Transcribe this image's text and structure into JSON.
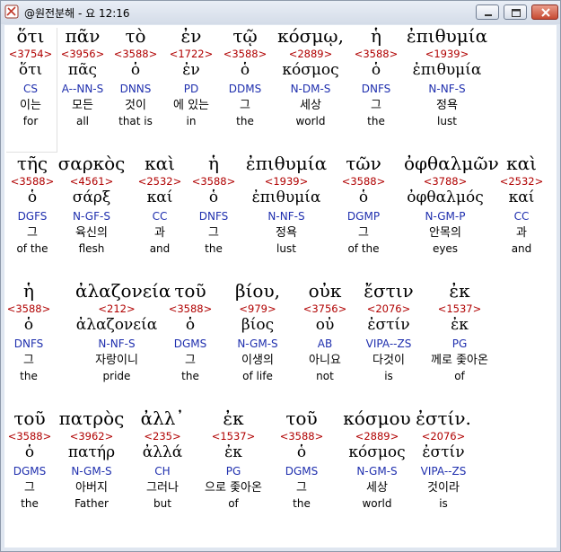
{
  "window": {
    "title": "@원전분해 - 요 12:16"
  },
  "rows": [
    [
      {
        "greek": "ὅτι",
        "strong": "<3754>",
        "lemma": "ὅτι",
        "parse": "CS",
        "korean": "이는",
        "english": "for"
      },
      {
        "greek": "πᾶν",
        "strong": "<3956>",
        "lemma": "πᾶς",
        "parse": "A--NN-S",
        "korean": "모든",
        "english": "all"
      },
      {
        "greek": "τὸ",
        "strong": "<3588>",
        "lemma": "ὁ",
        "parse": "DNNS",
        "korean": "것이",
        "english": "that is"
      },
      {
        "greek": "ἐν",
        "strong": "<1722>",
        "lemma": "ἐν",
        "parse": "PD",
        "korean": "에 있는",
        "english": "in"
      },
      {
        "greek": "τῷ",
        "strong": "<3588>",
        "lemma": "ὁ",
        "parse": "DDMS",
        "korean": "그",
        "english": "the"
      },
      {
        "greek": "κόσμῳ,",
        "strong": "<2889>",
        "lemma": "κόσμος",
        "parse": "N-DM-S",
        "korean": "세상",
        "english": "world"
      },
      {
        "greek": "ἡ",
        "strong": "<3588>",
        "lemma": "ὁ",
        "parse": "DNFS",
        "korean": "그",
        "english": "the"
      },
      {
        "greek": "ἐπιθυμία",
        "strong": "<1939>",
        "lemma": "ἐπιθυμία",
        "parse": "N-NF-S",
        "korean": "정욕",
        "english": "lust"
      }
    ],
    [
      {
        "greek": "τῆς",
        "strong": "<3588>",
        "lemma": "ὁ",
        "parse": "DGFS",
        "korean": "그",
        "english": "of the"
      },
      {
        "greek": "σαρκὸς",
        "strong": "<4561>",
        "lemma": "σάρξ",
        "parse": "N-GF-S",
        "korean": "육신의",
        "english": "flesh"
      },
      {
        "greek": "καὶ",
        "strong": "<2532>",
        "lemma": "καί",
        "parse": "CC",
        "korean": "과",
        "english": "and"
      },
      {
        "greek": "ἡ",
        "strong": "<3588>",
        "lemma": "ὁ",
        "parse": "DNFS",
        "korean": "그",
        "english": "the"
      },
      {
        "greek": "ἐπιθυμία",
        "strong": "<1939>",
        "lemma": "ἐπιθυμία",
        "parse": "N-NF-S",
        "korean": "정욕",
        "english": "lust"
      },
      {
        "greek": "τῶν",
        "strong": "<3588>",
        "lemma": "ὁ",
        "parse": "DGMP",
        "korean": "그",
        "english": "of the"
      },
      {
        "greek": "ὀφθαλμῶν",
        "strong": "<3788>",
        "lemma": "ὀφθαλμός",
        "parse": "N-GM-P",
        "korean": "안목의",
        "english": "eyes"
      },
      {
        "greek": "καὶ",
        "strong": "<2532>",
        "lemma": "καί",
        "parse": "CC",
        "korean": "과",
        "english": "and"
      }
    ],
    [
      {
        "greek": "ἡ",
        "strong": "<3588>",
        "lemma": "ὁ",
        "parse": "DNFS",
        "korean": "그",
        "english": "the"
      },
      {
        "greek": "ἀλαζονεία",
        "strong": "<212>",
        "lemma": "ἀλαζονεία",
        "parse": "N-NF-S",
        "korean": "자랑이니",
        "english": "pride"
      },
      {
        "greek": "τοῦ",
        "strong": "<3588>",
        "lemma": "ὁ",
        "parse": "DGMS",
        "korean": "그",
        "english": "the"
      },
      {
        "greek": "βίου,",
        "strong": "<979>",
        "lemma": "βίος",
        "parse": "N-GM-S",
        "korean": "이생의",
        "english": "of life"
      },
      {
        "greek": "οὐκ",
        "strong": "<3756>",
        "lemma": "οὐ",
        "parse": "AB",
        "korean": "아니요",
        "english": "not"
      },
      {
        "greek": "ἔστιν",
        "strong": "<2076>",
        "lemma": "ἐστίν",
        "parse": "VIPA--ZS",
        "korean": "다것이",
        "english": "is"
      },
      {
        "greek": "ἐκ",
        "strong": "<1537>",
        "lemma": "ἐκ",
        "parse": "PG",
        "korean": "께로 좇아온",
        "english": "of"
      }
    ],
    [
      {
        "greek": "τοῦ",
        "strong": "<3588>",
        "lemma": "ὁ",
        "parse": "DGMS",
        "korean": "그",
        "english": "the"
      },
      {
        "greek": "πατρὸς",
        "strong": "<3962>",
        "lemma": "πατήρ",
        "parse": "N-GM-S",
        "korean": "아버지",
        "english": "Father"
      },
      {
        "greek": "ἀλλ᾽",
        "strong": "<235>",
        "lemma": "ἀλλά",
        "parse": "CH",
        "korean": "그러나",
        "english": "but"
      },
      {
        "greek": "ἐκ",
        "strong": "<1537>",
        "lemma": "ἐκ",
        "parse": "PG",
        "korean": "으로 좇아온",
        "english": "of"
      },
      {
        "greek": "τοῦ",
        "strong": "<3588>",
        "lemma": "ὁ",
        "parse": "DGMS",
        "korean": "그",
        "english": "the"
      },
      {
        "greek": "κόσμου",
        "strong": "<2889>",
        "lemma": "κόσμος",
        "parse": "N-GM-S",
        "korean": "세상",
        "english": "world"
      },
      {
        "greek": "ἐστίν.",
        "strong": "<2076>",
        "lemma": "ἐστίν",
        "parse": "VIPA--ZS",
        "korean": "것이라",
        "english": "is"
      }
    ]
  ]
}
